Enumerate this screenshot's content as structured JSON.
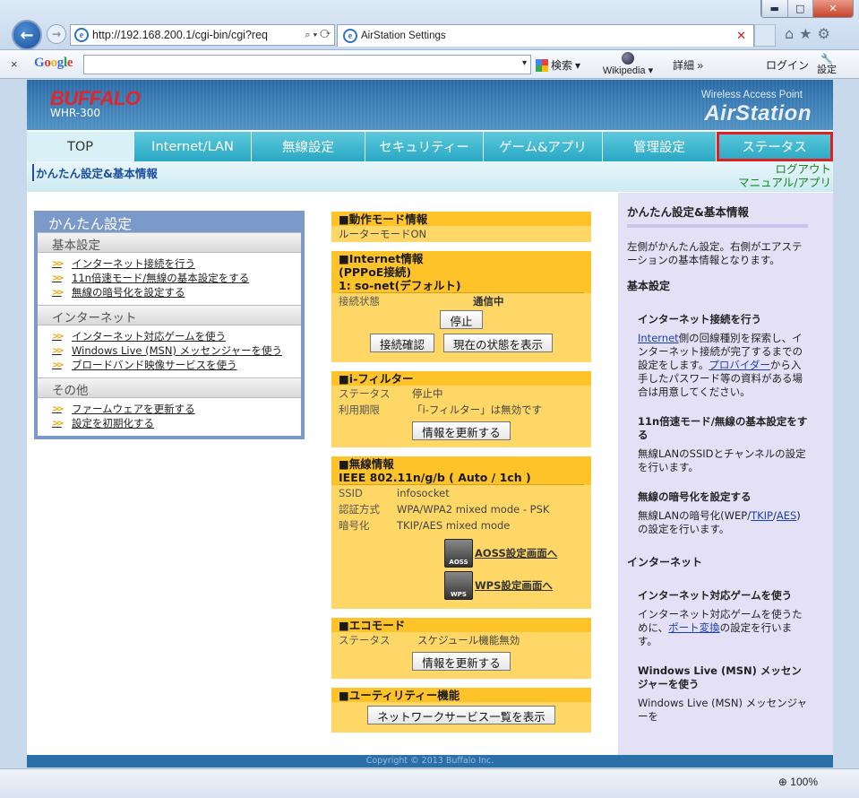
{
  "browser": {
    "window_controls": {
      "minimize": "▬",
      "maximize": "□",
      "close": "✕"
    },
    "back_icon": "←",
    "forward_icon": "→",
    "address": "http://192.168.200.1/cgi-bin/cgi?req",
    "address_controls": "⌕ ▾ ⟳",
    "tab_title": "AirStation Settings",
    "tab_close": "✕",
    "right_icons": [
      "home-icon",
      "star-icon",
      "gear-icon"
    ],
    "right_icon_glyphs": {
      "home": "⌂",
      "star": "★",
      "gear": "⚙"
    },
    "zoom": "100%"
  },
  "google_toolbar": {
    "close": "×",
    "logo": "Google",
    "search_dropdown": "▾",
    "search_button": "検索",
    "search_button_dd": "▾",
    "wikipedia": "Wikipedia",
    "wikipedia_dd": "▾",
    "more": "詳細 »",
    "login": "ログイン",
    "settings_icon": "🔧",
    "settings": "設定"
  },
  "router": {
    "brand": "BUFFALO",
    "model": "WHR-300",
    "product_sub": "Wireless Access Point",
    "product": "AirStation",
    "menu": [
      "TOP",
      "Internet/LAN",
      "無線設定",
      "セキュリティー",
      "ゲーム&アプリ",
      "管理設定",
      "ステータス"
    ],
    "breadcrumb": "かんたん設定&基本情報",
    "logout": "ログアウト",
    "manual": "マニュアル/アプリ",
    "footer": "Copyright © 2013 Buffalo Inc."
  },
  "easy_setup": {
    "title": "かんたん設定",
    "sections": [
      {
        "heading": "基本設定",
        "links": [
          "インターネット接続を行う",
          "11n倍速モード/無線の基本設定をする",
          "無線の暗号化を設定する"
        ]
      },
      {
        "heading": "インターネット",
        "links": [
          "インターネット対応ゲームを使う",
          "Windows Live (MSN) メッセンジャーを使う",
          "ブロードバンド映像サービスを使う"
        ]
      },
      {
        "heading": "その他",
        "links": [
          "ファームウェアを更新する",
          "設定を初期化する"
        ]
      }
    ]
  },
  "panels": {
    "mode": {
      "title": "■動作モード情報",
      "value": "ルーターモードON"
    },
    "internet": {
      "title1": "■Internet情報",
      "title2": "(PPPoE接続)",
      "title3": "1: so-net(デフォルト)",
      "status_key": "接続状態",
      "status_val": "通信中",
      "stop_btn": "停止",
      "check_btn": "接続確認",
      "show_btn": "現在の状態を表示"
    },
    "ifilter": {
      "title": "■i-フィルター",
      "status_key": "ステータス",
      "status_val": "停止中",
      "period_key": "利用期限",
      "period_val": "「i-フィルター」は無効です",
      "update_btn": "情報を更新する"
    },
    "wireless": {
      "title": "■無線情報",
      "standard": "IEEE 802.11n/g/b ( Auto / 1ch )",
      "rows": [
        [
          "SSID",
          "infosocket"
        ],
        [
          "認証方式",
          "WPA/WPA2 mixed mode - PSK"
        ],
        [
          "暗号化",
          "TKIP/AES mixed mode"
        ]
      ],
      "aoss_label": "AOSS",
      "aoss_link": "AOSS設定画面へ",
      "wps_label": "WPS",
      "wps_link": "WPS設定画面へ"
    },
    "eco": {
      "title": "■エコモード",
      "status_key": "ステータス",
      "status_val": "スケジュール機能無効",
      "update_btn": "情報を更新する"
    },
    "utility": {
      "title": "■ユーティリティー機能",
      "btn": "ネットワークサービス一覧を表示"
    }
  },
  "help": {
    "title": "かんたん設定&基本情報",
    "intro": "左側がかんたん設定。右側がエアステーションの基本情報となります。",
    "h_basic": "基本設定",
    "i1_title": "インターネット接続を行う",
    "i1_link1": "Internet",
    "i1_text1": "側の回線種別を探索し、インターネット接続が完了するまでの設定をします。",
    "i1_link2": "プロバイダー",
    "i1_text2": "から入手したパスワード等の資料がある場合は用意してください。",
    "i2_title": "11n倍速モード/無線の基本設定をする",
    "i2_text": "無線LANのSSIDとチャンネルの設定を行います。",
    "i3_title": "無線の暗号化を設定する",
    "i3_text1": "無線LANの暗号化(WEP/",
    "i3_link1": "TKIP",
    "i3_sep": "/",
    "i3_link2": "AES",
    "i3_text2": ")の設定を行います。",
    "h_inet": "インターネット",
    "i4_title": "インターネット対応ゲームを使う",
    "i4_text1": "インターネット対応ゲームを使うために、",
    "i4_link": "ポート変換",
    "i4_text2": "の設定を行います。",
    "i5_title": "Windows Live (MSN) メッセンジャーを使う",
    "i5_text": "Windows Live (MSN) メッセンジャーを"
  }
}
